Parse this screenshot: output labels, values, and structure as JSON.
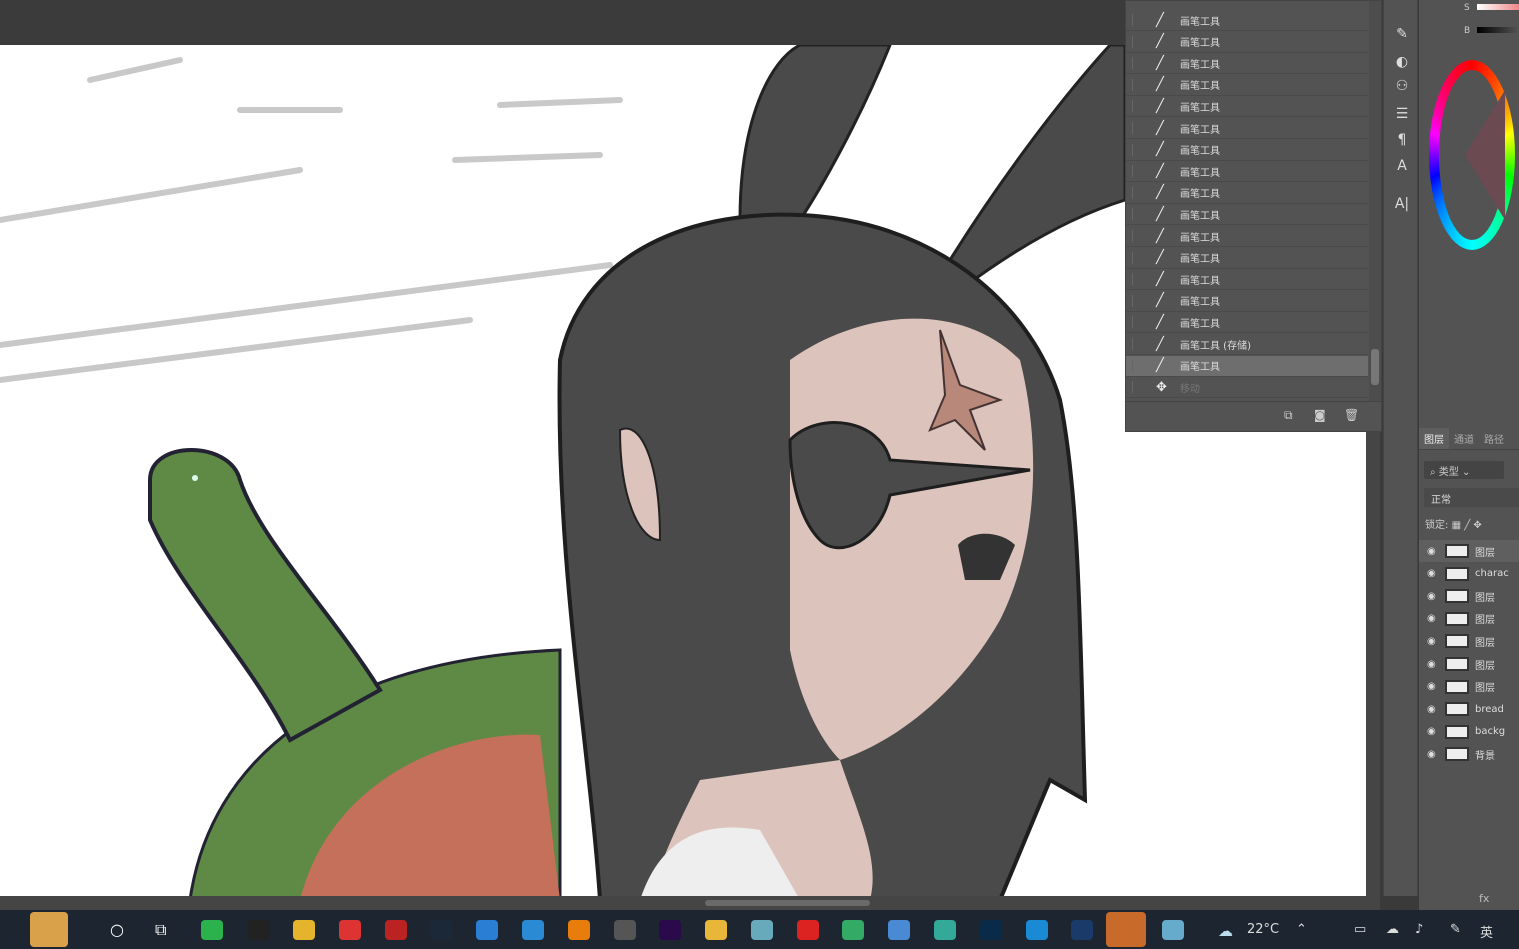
{
  "history": {
    "items": [
      "画笔工具",
      "画笔工具",
      "画笔工具",
      "画笔工具",
      "画笔工具",
      "画笔工具",
      "画笔工具",
      "画笔工具",
      "画笔工具",
      "画笔工具",
      "画笔工具",
      "画笔工具",
      "画笔工具",
      "画笔工具",
      "画笔工具",
      "画笔工具 (存储)",
      "画笔工具"
    ],
    "dim_item": "移动",
    "selected_index": 16
  },
  "color": {
    "s_label": "S",
    "b_label": "B"
  },
  "layers": {
    "tabs": [
      "图层",
      "通道",
      "路径"
    ],
    "filter": "类型",
    "blend_mode": "正常",
    "lock_label": "锁定:",
    "items": [
      "图层",
      "charac",
      "图层",
      "图层",
      "图层",
      "图层",
      "图层",
      "bread",
      "backg",
      "背景"
    ],
    "footer": "fx"
  },
  "taskbar": {
    "temperature": "22°C",
    "ime": "英"
  }
}
